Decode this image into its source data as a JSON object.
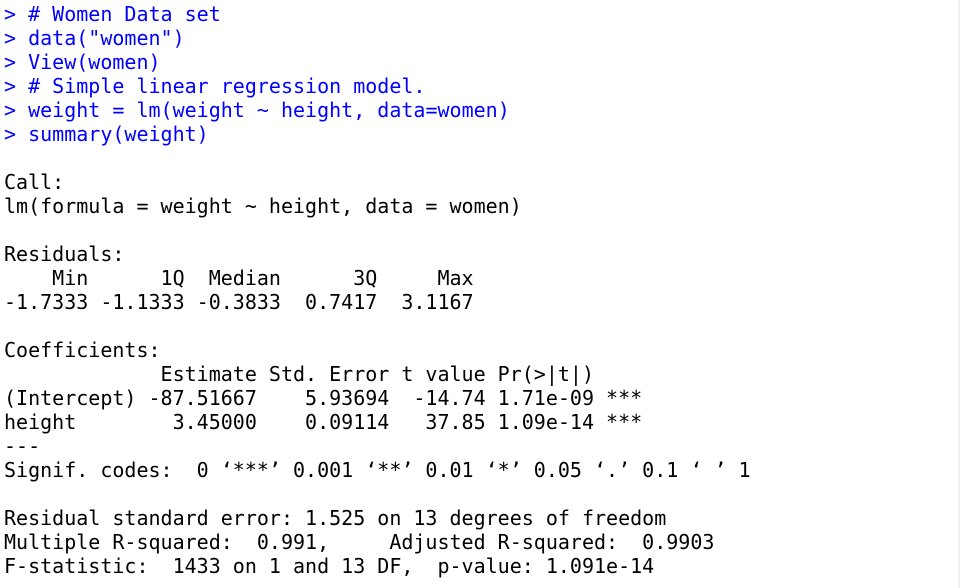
{
  "colors": {
    "input": "#0000ff",
    "output": "#000000",
    "background": "#ffffff"
  },
  "prompt_symbol": "> ",
  "commands": [
    "# Women Data set",
    "data(\"women\")",
    "View(women)",
    "# Simple linear regression model.",
    "weight = lm(weight ~ height, data=women)",
    "summary(weight)"
  ],
  "output": {
    "call_header": "Call:",
    "call_formula": "lm(formula = weight ~ height, data = women)",
    "residuals_header": "Residuals:",
    "residuals_labels": "    Min      1Q  Median      3Q     Max ",
    "residuals_values": "-1.7333 -1.1333 -0.3833  0.7417  3.1167 ",
    "coefficients_header": "Coefficients:",
    "coefficients_columns": "             Estimate Std. Error t value Pr(>|t|)    ",
    "coefficients_rows": [
      "(Intercept) -87.51667    5.93694  -14.74 1.71e-09 ***",
      "height        3.45000    0.09114   37.85 1.09e-14 ***"
    ],
    "separator": "---",
    "signif_codes": "Signif. codes:  0 ‘***’ 0.001 ‘**’ 0.01 ‘*’ 0.05 ‘.’ 0.1 ‘ ’ 1",
    "residual_se": "Residual standard error: 1.525 on 13 degrees of freedom",
    "r_squared": "Multiple R-squared:  0.991,\tAdjusted R-squared:  0.9903 ",
    "f_statistic": "F-statistic:  1433 on 1 and 13 DF,  p-value: 1.091e-14"
  }
}
